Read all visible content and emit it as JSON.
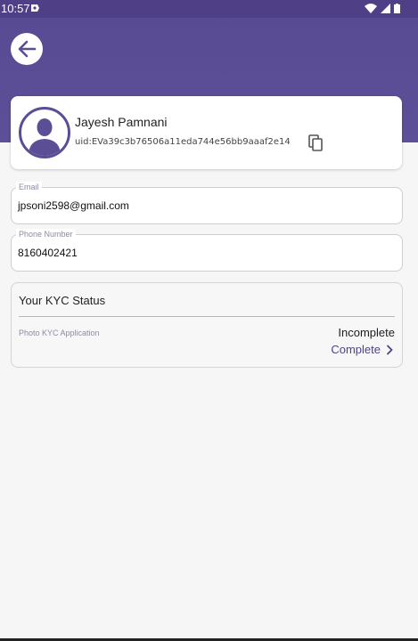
{
  "status_bar": {
    "time": "10:57"
  },
  "profile": {
    "name": "Jayesh Pamnani",
    "uid": "uid:EVa39c3b76506a11eda744e56bb9aaaf2e14"
  },
  "email": {
    "label": "Email",
    "value": "jpsoni2598@gmail.com"
  },
  "phone": {
    "label": "Phone Number",
    "value": "8160402421"
  },
  "kyc": {
    "title": "Your KYC Status",
    "application_label": "Photo KYC Application",
    "status": "Incomplete",
    "action_label": "Complete"
  },
  "colors": {
    "primary": "#594b93",
    "accent": "#4f438a"
  }
}
